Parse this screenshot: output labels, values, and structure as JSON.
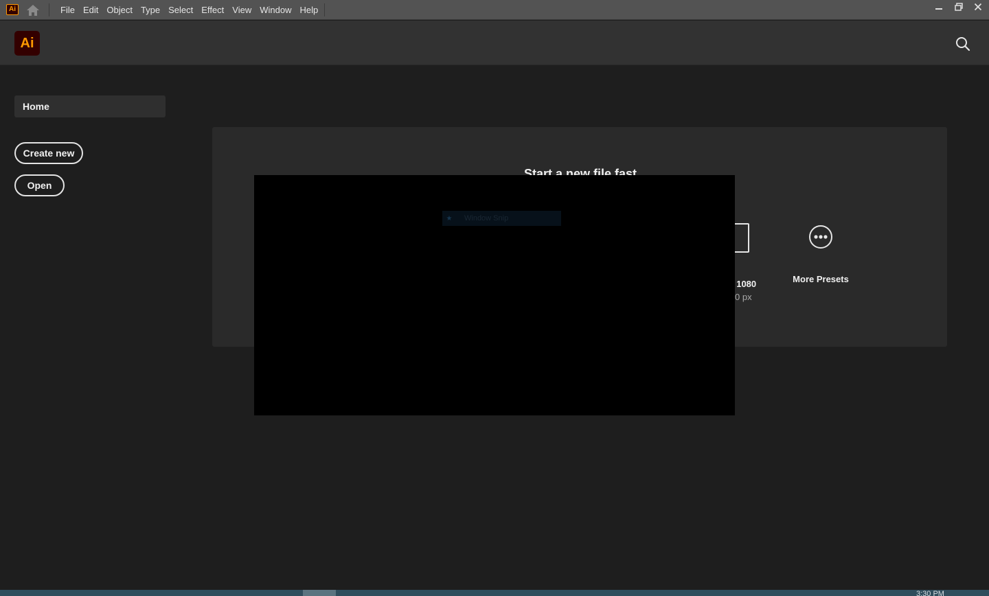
{
  "menubar": {
    "app_badge": "Ai",
    "home_icon": "home-icon",
    "items": [
      "File",
      "Edit",
      "Object",
      "Type",
      "Select",
      "Effect",
      "View",
      "Window",
      "Help"
    ],
    "window_controls": {
      "minimize": "–",
      "restore": "❐",
      "close": "✕"
    }
  },
  "header": {
    "logo_text": "Ai",
    "search_icon": "search-icon"
  },
  "sidebar": {
    "home_label": "Home",
    "create_new_label": "Create new",
    "open_label": "Open"
  },
  "quick_start": {
    "title": "Start a new file fast",
    "visible_preset": {
      "name_fragment": "/ 1080",
      "size_fragment": "0 px"
    },
    "more_presets_label": "More Presets",
    "more_presets_icon": "ellipsis-circle-icon"
  },
  "snip_overlay": {
    "label": "Window Snip"
  },
  "taskbar": {
    "clock": "3:30 PM"
  },
  "colors": {
    "accent_orange": "#ff9a00",
    "logo_bg": "#330000",
    "menubar_bg": "#535353",
    "header_bg": "#323232",
    "body_bg": "#1e1e1e",
    "card_bg": "#2a2a2a"
  }
}
